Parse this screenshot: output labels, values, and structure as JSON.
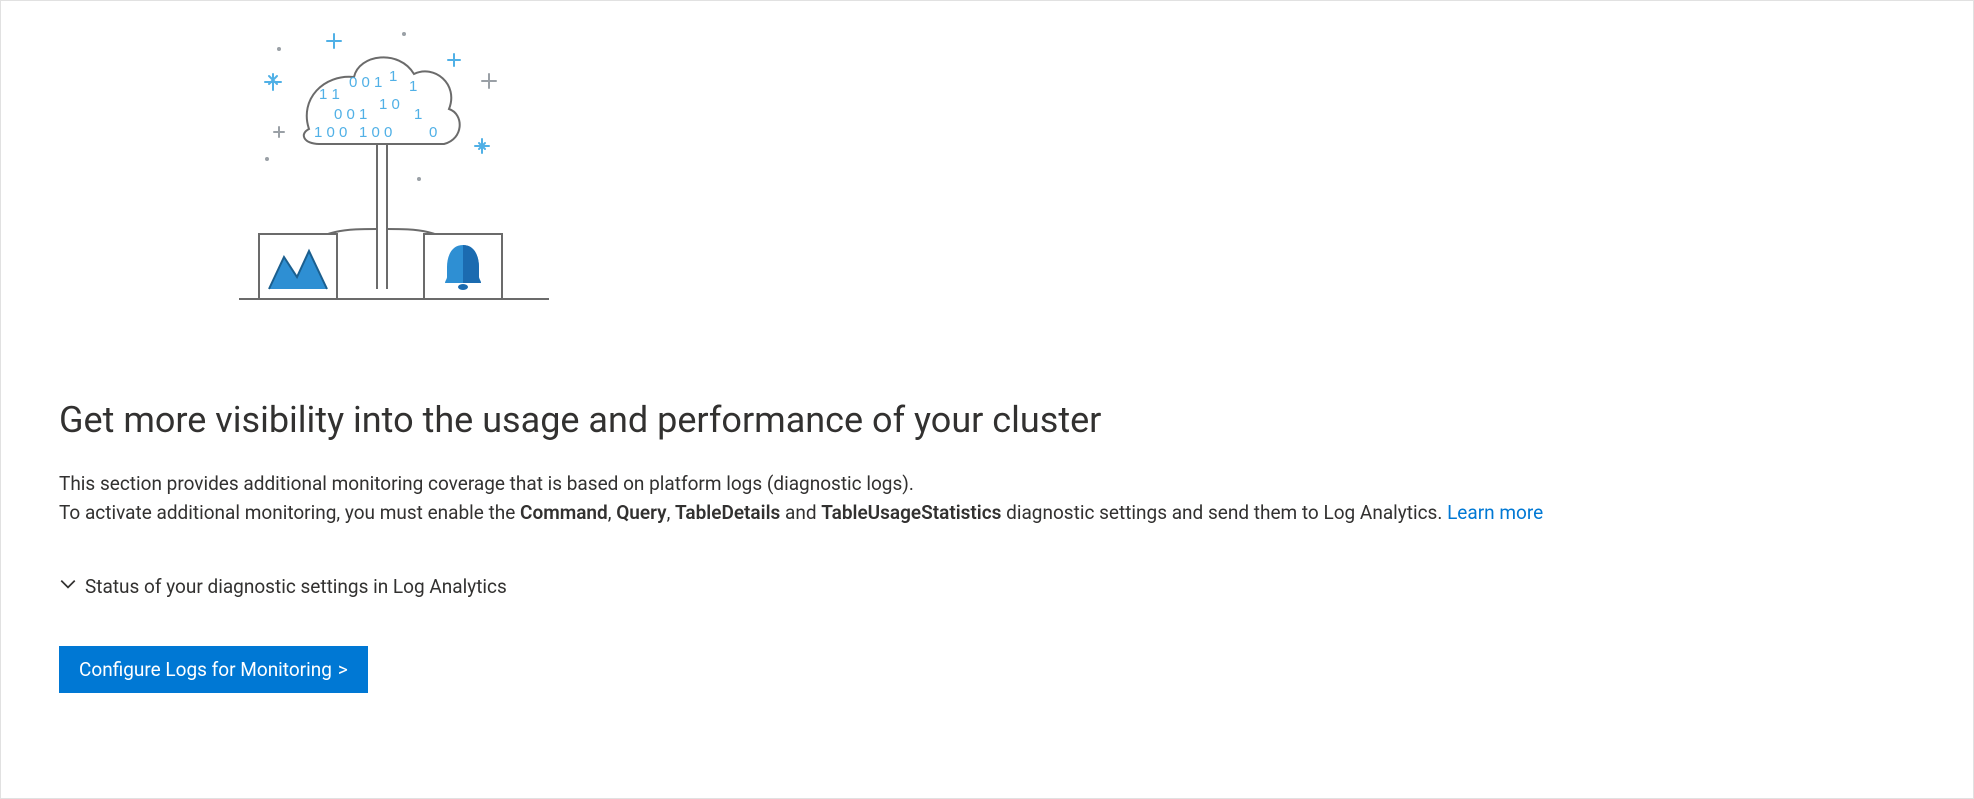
{
  "heading": "Get more visibility into the usage and performance of your cluster",
  "desc": {
    "line1": "This section provides additional monitoring coverage that is based on platform logs (diagnostic logs).",
    "line2_prefix": "To activate additional monitoring, you must enable the ",
    "bold1": "Command",
    "comma1": ", ",
    "bold2": "Query",
    "comma2": ", ",
    "bold3": "TableDetails",
    "and": " and ",
    "bold4": "TableUsageStatistics",
    "line2_suffix": " diagnostic settings and send them to Log Analytics. ",
    "learn_more": "Learn more"
  },
  "expander_label": "Status of your diagnostic settings in Log Analytics",
  "button_label": "Configure Logs for Monitoring",
  "button_chevron": ">"
}
